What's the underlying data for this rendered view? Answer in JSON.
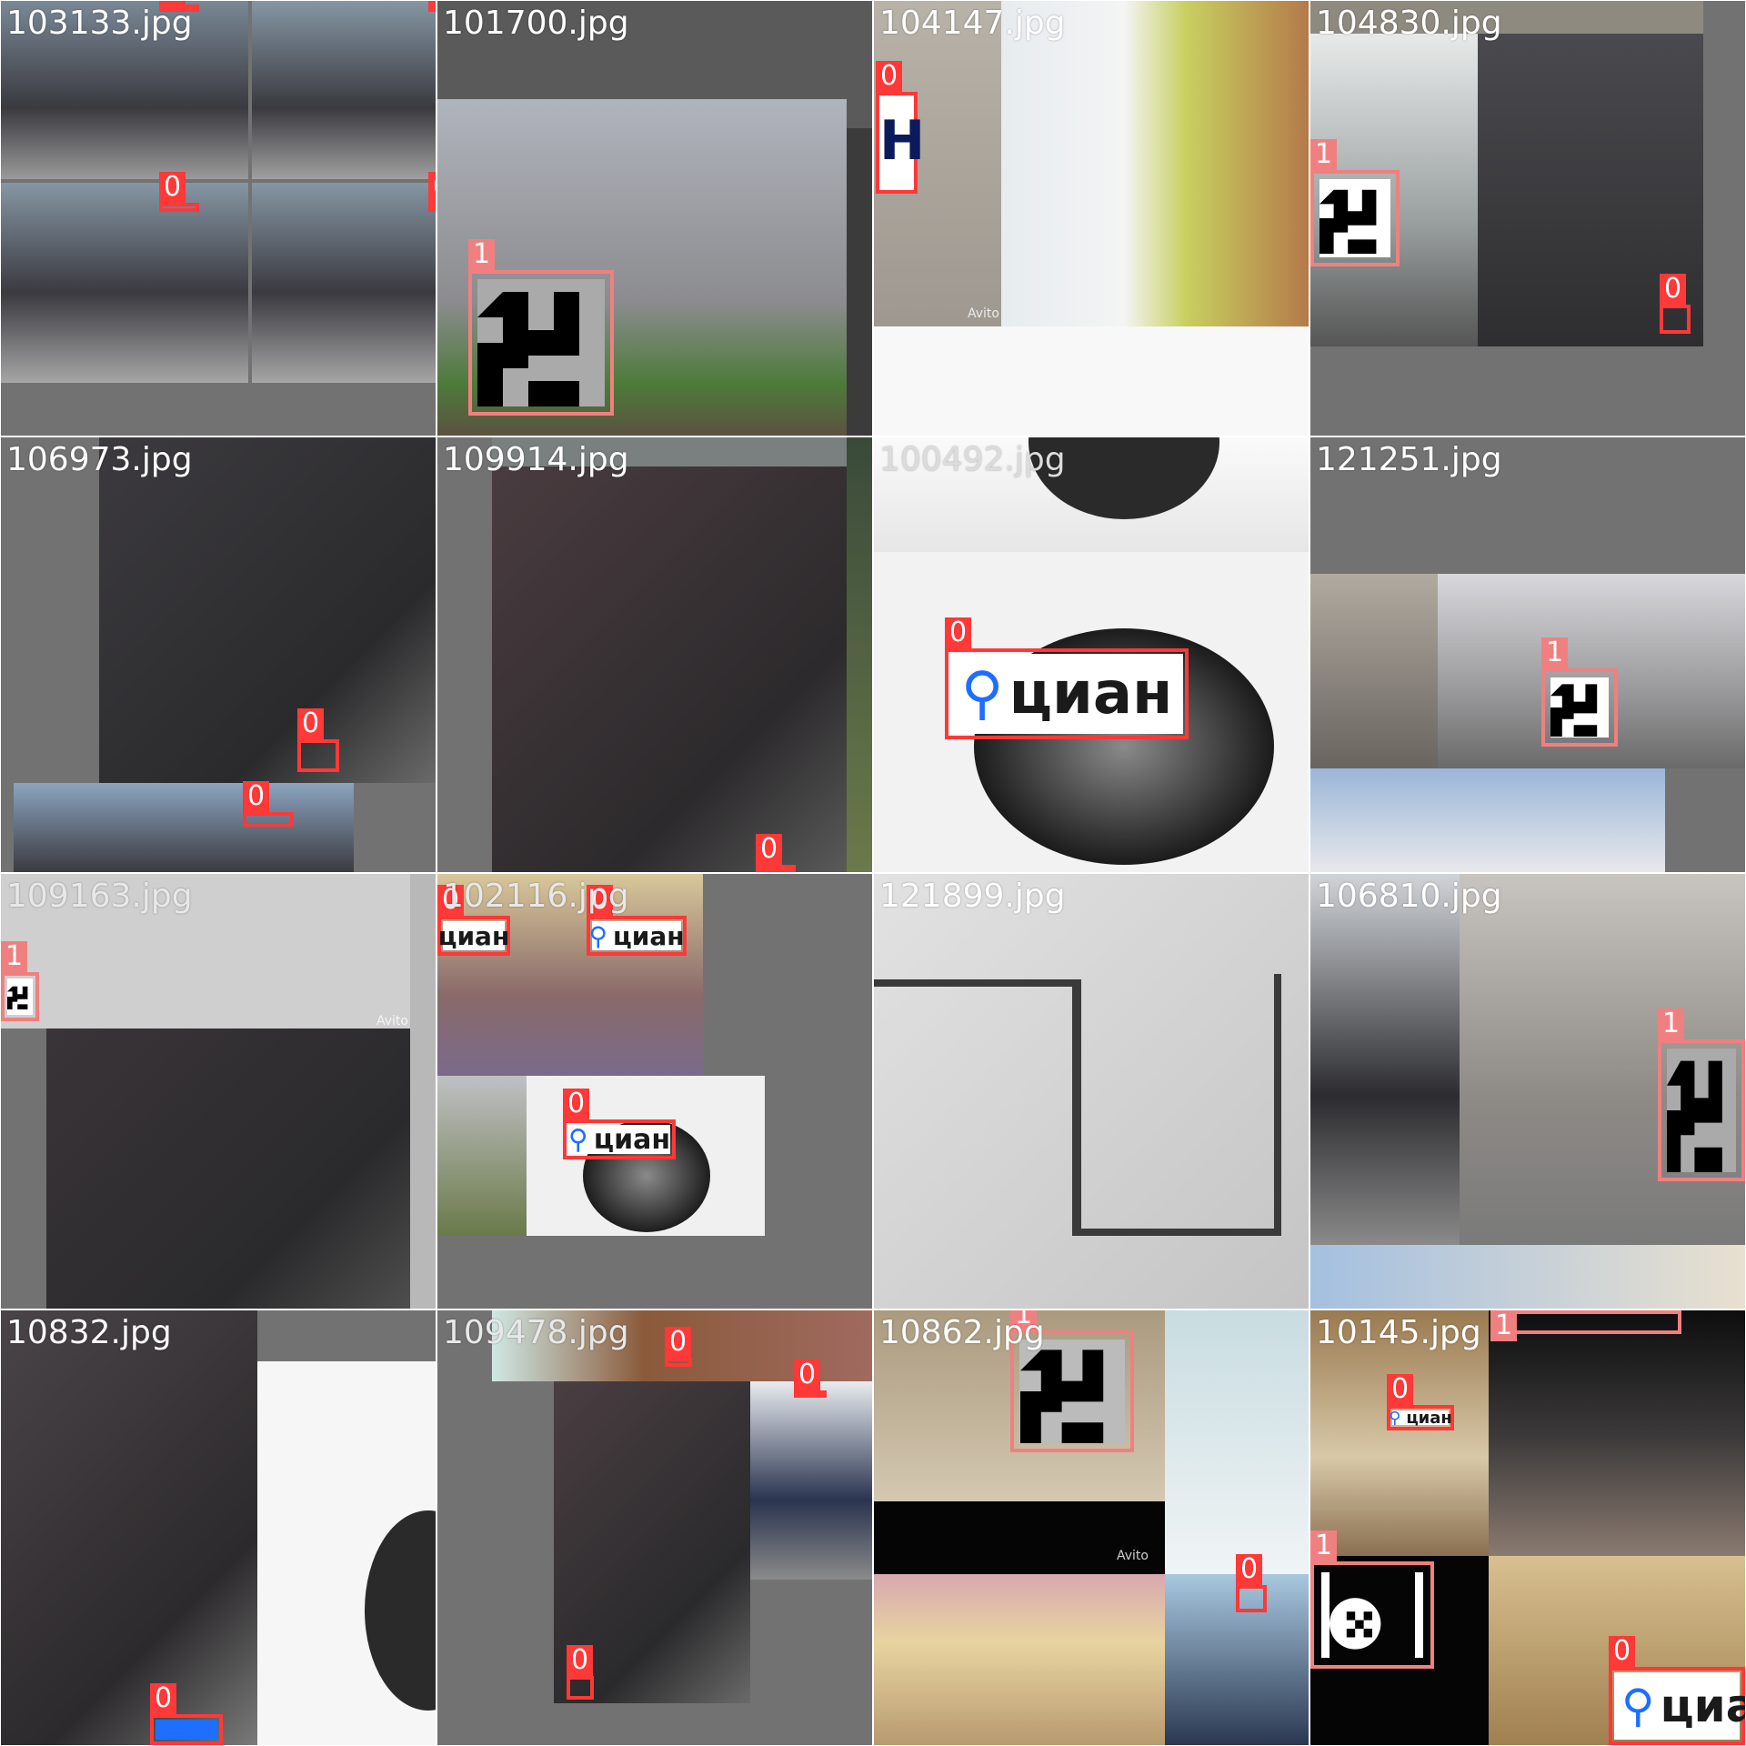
{
  "tiles": [
    {
      "file": "103133.jpg"
    },
    {
      "file": "101700.jpg"
    },
    {
      "file": "104147.jpg"
    },
    {
      "file": "104830.jpg"
    },
    {
      "file": "106973.jpg"
    },
    {
      "file": "109914.jpg"
    },
    {
      "file": "100492.jpg"
    },
    {
      "file": "121251.jpg"
    },
    {
      "file": "109163.jpg"
    },
    {
      "file": "102116.jpg"
    },
    {
      "file": "121899.jpg"
    },
    {
      "file": "106810.jpg"
    },
    {
      "file": "10832.jpg"
    },
    {
      "file": "109478.jpg"
    },
    {
      "file": "10862.jpg"
    },
    {
      "file": "10145.jpg"
    }
  ],
  "labels": {
    "logo": "0",
    "symbol": "1"
  },
  "logo_text": "циан",
  "logo_text_cut": "циа",
  "watermark": "Avito",
  "colors": {
    "logo_box": "#ff3838",
    "symbol_box": "#f08080",
    "pin": "#1e6fff",
    "background": "#727272"
  }
}
